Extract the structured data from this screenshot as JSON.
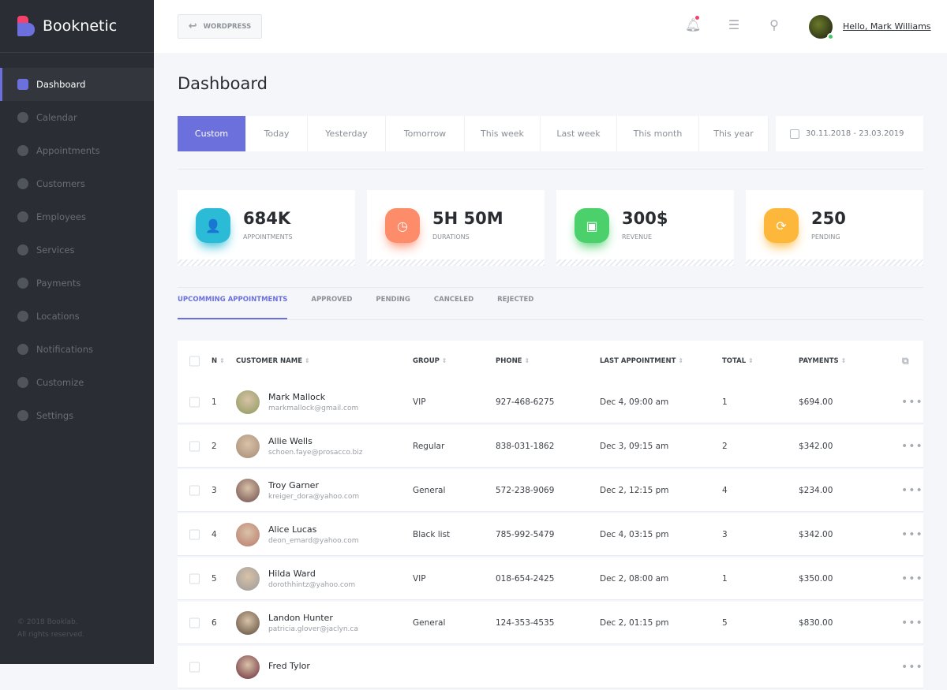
{
  "app": {
    "name": "Booknetic",
    "footer_line1": "© 2018 Booklab.",
    "footer_line2": "All rights reserved."
  },
  "sidebar": {
    "items": [
      {
        "label": "Dashboard",
        "icon": "cube-icon"
      },
      {
        "label": "Calendar",
        "icon": "plus-circle-icon"
      },
      {
        "label": "Appointments",
        "icon": "clock-icon"
      },
      {
        "label": "Customers",
        "icon": "user-icon"
      },
      {
        "label": "Employees",
        "icon": "users-icon"
      },
      {
        "label": "Services",
        "icon": "list-icon"
      },
      {
        "label": "Payments",
        "icon": "payment-icon"
      },
      {
        "label": "Locations",
        "icon": "location-arrow-icon"
      },
      {
        "label": "Notifications",
        "icon": "bell-icon"
      },
      {
        "label": "Customize",
        "icon": "brush-icon"
      },
      {
        "label": "Settings",
        "icon": "gear-icon"
      }
    ]
  },
  "header": {
    "wordpress": "WORDPRESS",
    "greeting": "Hello, Mark Williams"
  },
  "page": {
    "title": "Dashboard"
  },
  "ranges": [
    {
      "label": "Custom"
    },
    {
      "label": "Today"
    },
    {
      "label": "Yesterday"
    },
    {
      "label": "Tomorrow"
    },
    {
      "label": "This week"
    },
    {
      "label": "Last week"
    },
    {
      "label": "This month"
    },
    {
      "label": "This year"
    }
  ],
  "date_range": "30.11.2018 - 23.03.2019",
  "stats": [
    {
      "value": "684K",
      "label": "APPOINTMENTS",
      "color": "#2bbbd6",
      "icon": "👤"
    },
    {
      "value": "5H 50M",
      "label": "DURATIONS",
      "color": "#fd8c6a",
      "icon": "◷"
    },
    {
      "value": "300$",
      "label": "REVENUE",
      "color": "#4cd06c",
      "icon": "▣"
    },
    {
      "value": "250",
      "label": "PENDING",
      "color": "#fdb73a",
      "icon": "⟳"
    }
  ],
  "tabs": [
    {
      "label": "UPCOMMING APPOINTMENTS"
    },
    {
      "label": "APPROVED"
    },
    {
      "label": "PENDING"
    },
    {
      "label": "CANCELED"
    },
    {
      "label": "REJECTED"
    }
  ],
  "table": {
    "columns": {
      "n": "N",
      "customer": "CUSTOMER NAME",
      "group": "GROUP",
      "phone": "PHONE",
      "last": "LAST APPOINTMENT",
      "total": "TOTAL",
      "payments": "PAYMENTS"
    },
    "rows": [
      {
        "n": "1",
        "name": "Mark Mallock",
        "email": "markmallock@gmail.com",
        "group": "VIP",
        "phone": "927-468-6275",
        "last": "Dec 4, 09:00 am",
        "total": "1",
        "payments": "$694.00"
      },
      {
        "n": "2",
        "name": "Allie Wells",
        "email": "schoen.faye@prosacco.biz",
        "group": "Regular",
        "phone": "838-031-1862",
        "last": "Dec 3, 09:15 am",
        "total": "2",
        "payments": "$342.00"
      },
      {
        "n": "3",
        "name": "Troy Garner",
        "email": "kreiger_dora@yahoo.com",
        "group": "General",
        "phone": "572-238-9069",
        "last": "Dec 2, 12:15 pm",
        "total": "4",
        "payments": "$234.00"
      },
      {
        "n": "4",
        "name": "Alice Lucas",
        "email": "deon_emard@yahoo.com",
        "group": "Black list",
        "phone": "785-992-5479",
        "last": "Dec 4, 03:15 pm",
        "total": "3",
        "payments": "$342.00"
      },
      {
        "n": "5",
        "name": "Hilda Ward",
        "email": "dorothhintz@yahoo.com",
        "group": "VIP",
        "phone": "018-654-2425",
        "last": "Dec 2, 08:00 am",
        "total": "1",
        "payments": "$350.00"
      },
      {
        "n": "6",
        "name": "Landon Hunter",
        "email": "patricia.glover@jaclyn.ca",
        "group": "General",
        "phone": "124-353-4535",
        "last": "Dec 2, 01:15 pm",
        "total": "5",
        "payments": "$830.00"
      },
      {
        "n": "",
        "name": "Fred Tylor",
        "email": "",
        "group": "",
        "phone": "",
        "last": "",
        "total": "",
        "payments": ""
      }
    ]
  }
}
